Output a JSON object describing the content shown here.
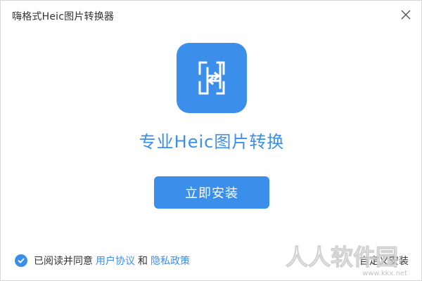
{
  "window": {
    "title": "嗨格式Heic图片转换器"
  },
  "icons": {
    "close": "close-icon",
    "logo": "heic-converter-logo-icon",
    "check": "checkmark-icon"
  },
  "main": {
    "headline": "专业Heic图片转换",
    "install_label": "立即安装"
  },
  "footer": {
    "agree_text": "已阅读并同意",
    "user_agreement": "用户协议",
    "and_text": "和",
    "privacy_policy": "隐私政策",
    "custom_install": "自定义安装"
  },
  "watermark": {
    "text": "人人软件园",
    "url": "www.kkx.net"
  },
  "colors": {
    "accent": "#3b8eea",
    "text": "#333333",
    "background": "#ffffff"
  }
}
